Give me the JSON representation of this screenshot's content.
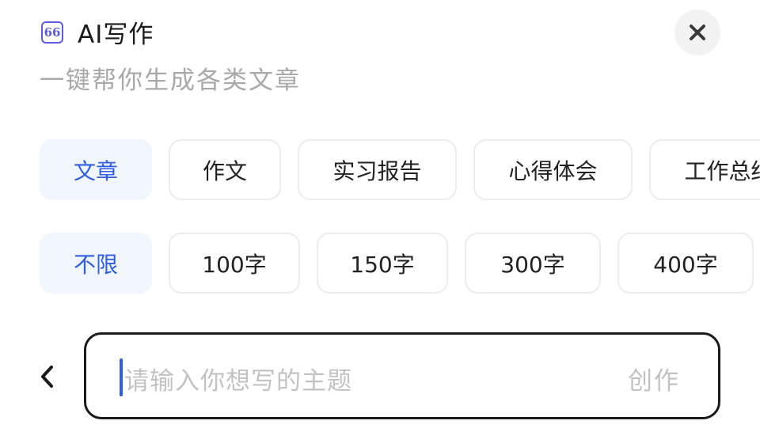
{
  "header": {
    "logo_glyph": "66",
    "title": "AI写作",
    "subtitle": "一键帮你生成各类文章"
  },
  "close_icon": "close-icon",
  "type_chips": [
    {
      "label": "文章",
      "selected": true
    },
    {
      "label": "作文",
      "selected": false
    },
    {
      "label": "实习报告",
      "selected": false
    },
    {
      "label": "心得体会",
      "selected": false
    },
    {
      "label": "工作总结",
      "selected": false
    }
  ],
  "length_chips": [
    {
      "label": "不限",
      "selected": true
    },
    {
      "label": "100字",
      "selected": false
    },
    {
      "label": "150字",
      "selected": false
    },
    {
      "label": "300字",
      "selected": false
    },
    {
      "label": "400字",
      "selected": false
    }
  ],
  "input": {
    "placeholder": "请输入你想写的主题",
    "value": "",
    "submit_label": "创作"
  },
  "colors": {
    "accent": "#2f5fe0",
    "logo": "#5b5ce2",
    "selected_bg": "#f1f5fe",
    "placeholder": "#c2c2c2"
  }
}
